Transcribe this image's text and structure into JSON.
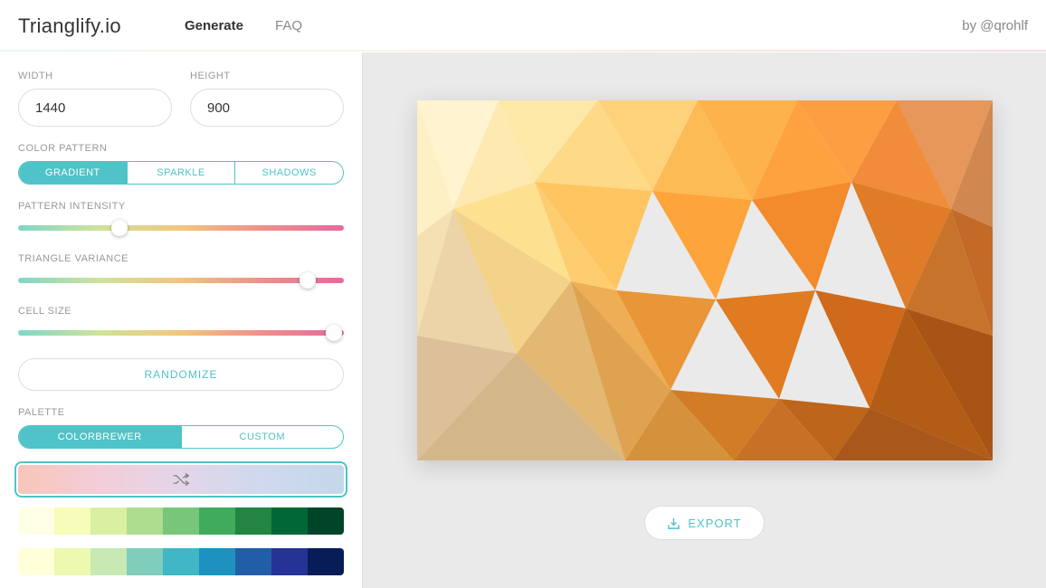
{
  "header": {
    "logo": "Trianglify.io",
    "nav": [
      {
        "label": "Generate",
        "active": true
      },
      {
        "label": "FAQ",
        "active": false
      }
    ],
    "byline": "by @qrohlf"
  },
  "controls": {
    "width": {
      "label": "WIDTH",
      "value": "1440"
    },
    "height": {
      "label": "HEIGHT",
      "value": "900"
    },
    "color_pattern": {
      "label": "COLOR PATTERN",
      "options": [
        "GRADIENT",
        "SPARKLE",
        "SHADOWS"
      ],
      "selected": 0
    },
    "pattern_intensity": {
      "label": "PATTERN INTENSITY",
      "value": 0.31
    },
    "triangle_variance": {
      "label": "TRIANGLE VARIANCE",
      "value": 0.89
    },
    "cell_size": {
      "label": "CELL SIZE",
      "value": 0.97
    },
    "randomize_label": "RANDOMIZE",
    "palette": {
      "label": "PALETTE",
      "tabs": [
        "COLORBREWER",
        "CUSTOM"
      ],
      "selected_tab": 0,
      "shuffle_selected": true,
      "rows": [
        [
          "#ffffe5",
          "#f7fcb9",
          "#d9f0a3",
          "#addd8e",
          "#78c679",
          "#41ab5d",
          "#238443",
          "#006837",
          "#004529"
        ],
        [
          "#ffffd9",
          "#edf8b1",
          "#c7e9b4",
          "#7fcdbb",
          "#41b6c4",
          "#1d91c0",
          "#225ea8",
          "#253494",
          "#081d58"
        ]
      ]
    }
  },
  "export_label": "EXPORT",
  "preview": {
    "triangles": [
      {
        "p": "0,0 90,0 40,120",
        "f": "#fff3d0"
      },
      {
        "p": "90,0 200,0 130,90",
        "f": "#fee8a8"
      },
      {
        "p": "200,0 310,0 260,100",
        "f": "#fed27a"
      },
      {
        "p": "310,0 420,0 370,110",
        "f": "#feb24c"
      },
      {
        "p": "420,0 530,0 480,90",
        "f": "#fd9e43"
      },
      {
        "p": "530,0 636,0 590,120",
        "f": "#e8975a"
      },
      {
        "p": "636,0 636,140 590,120",
        "f": "#d08850"
      },
      {
        "p": "0,0 40,120 0,150",
        "f": "#fdf0c5"
      },
      {
        "p": "40,120 130,90 90,0",
        "f": "#fee9b0"
      },
      {
        "p": "130,90 260,100 200,0",
        "f": "#fed986"
      },
      {
        "p": "260,100 370,110 310,0",
        "f": "#fdbb55"
      },
      {
        "p": "370,110 480,90 420,0",
        "f": "#fda23f"
      },
      {
        "p": "480,90 590,120 530,0",
        "f": "#f08c3a"
      },
      {
        "p": "40,120 0,150 0,260",
        "f": "#f5e0b2"
      },
      {
        "p": "40,120 130,90 170,200",
        "f": "#fee091"
      },
      {
        "p": "130,90 260,100 220,210",
        "f": "#fec560"
      },
      {
        "p": "260,100 370,110 330,220",
        "f": "#fda43a"
      },
      {
        "p": "370,110 480,90 440,210",
        "f": "#f38b2c"
      },
      {
        "p": "480,90 590,120 540,230",
        "f": "#e07b28"
      },
      {
        "p": "590,120 636,140 636,260",
        "f": "#c36a28"
      },
      {
        "p": "0,260 40,120 110,280",
        "f": "#ecd4a8"
      },
      {
        "p": "40,120 170,200 110,280",
        "f": "#f3d38a"
      },
      {
        "p": "170,200 220,210 130,90",
        "f": "#fecd6f"
      },
      {
        "p": "170,200 220,210 280,320",
        "f": "#eeae55"
      },
      {
        "p": "220,210 330,220 280,320",
        "f": "#e89638"
      },
      {
        "p": "330,220 440,210 400,330",
        "f": "#e07b22"
      },
      {
        "p": "440,210 540,230 500,340",
        "f": "#cf6a1c"
      },
      {
        "p": "540,230 636,260 636,398",
        "f": "#a85416"
      },
      {
        "p": "0,260 110,280 0,398",
        "f": "#dbc09a"
      },
      {
        "p": "110,280 170,200 230,398",
        "f": "#e2b872"
      },
      {
        "p": "170,200 280,320 230,398",
        "f": "#dfa250"
      },
      {
        "p": "280,320 400,330 350,398",
        "f": "#d27c25"
      },
      {
        "p": "400,330 500,340 460,398",
        "f": "#bd651a"
      },
      {
        "p": "500,340 636,398 540,230",
        "f": "#b35c16"
      },
      {
        "p": "0,398 110,280 230,398",
        "f": "#d4b788"
      },
      {
        "p": "230,398 280,320 350,398",
        "f": "#d6913c"
      },
      {
        "p": "350,398 400,330 460,398",
        "f": "#c77127"
      },
      {
        "p": "460,398 500,340 636,398",
        "f": "#a9571a"
      },
      {
        "p": "590,120 540,230 636,260",
        "f": "#c8732c"
      }
    ]
  }
}
